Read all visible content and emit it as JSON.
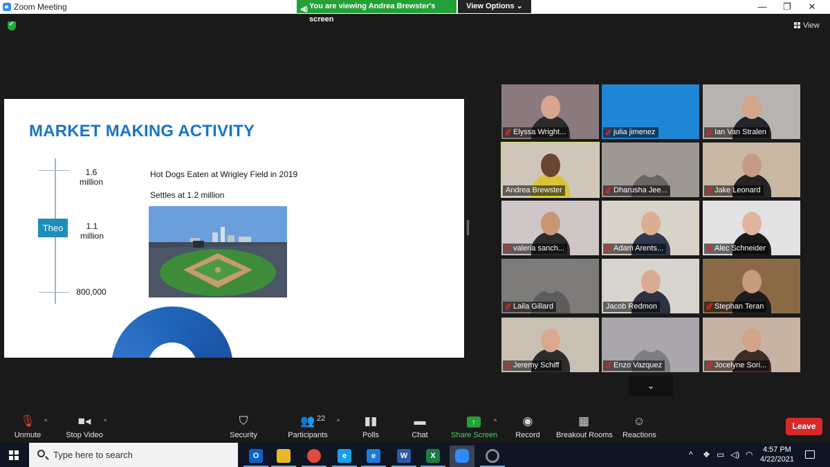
{
  "window": {
    "title": "Zoom Meeting",
    "banner": "You are viewing Andrea Brewster's screen",
    "view_options": "View Options",
    "view": "View"
  },
  "slide": {
    "title": "MARKET MAKING ACTIVITY",
    "axis": {
      "top_label": "1.6 million",
      "mid_label": "1.1 million",
      "bottom_label": "800,000",
      "marker": "Theo"
    },
    "line1": "Hot Dogs Eaten at Wrigley Field in 2019",
    "line2": "Settles at 1.2 million",
    "photo_icon": "baseball-stadium-photo"
  },
  "participants": [
    {
      "name": "Elyssa Wright...",
      "bg": "#8a7a7e",
      "skin": "#d9a58f",
      "shirt": "#2a2a2a",
      "muted": true
    },
    {
      "name": "julia jimenez",
      "bg": "#1f86d6",
      "skin": "#1f86d6",
      "shirt": "#1f86d6",
      "muted": true
    },
    {
      "name": "Ian Van Stralen",
      "bg": "#b7b3b0",
      "skin": "#d3a68c",
      "shirt": "#24262c",
      "muted": true
    },
    {
      "name": "Andrea Brewster",
      "bg": "#cfc6b9",
      "skin": "#6b4531",
      "shirt": "#d8c43a",
      "muted": false,
      "active": true
    },
    {
      "name": "Dharusha Jee...",
      "bg": "#9d9891",
      "skin": "#9d9891",
      "shirt": "#6a6560",
      "muted": true
    },
    {
      "name": "Jake Leonard",
      "bg": "#c8b8a3",
      "skin": "#c79b83",
      "shirt": "#242424",
      "muted": true
    },
    {
      "name": "valeria sanch...",
      "bg": "#cfc7c7",
      "skin": "#c99674",
      "shirt": "#2b2b2b",
      "muted": true
    },
    {
      "name": "Adam Arents...",
      "bg": "#d8d2c8",
      "skin": "#dcae92",
      "shirt": "#2e3a4d",
      "muted": true
    },
    {
      "name": "Alec Schneider",
      "bg": "#e2e2e2",
      "skin": "#e0b49e",
      "shirt": "#1a1a1a",
      "muted": true
    },
    {
      "name": "Laila Gillard",
      "bg": "#7e7c7b",
      "skin": "#7e7c7b",
      "shirt": "#5e5c5b",
      "muted": true
    },
    {
      "name": "Jacob Redmon",
      "bg": "#d7d4cf",
      "skin": "#d9ab92",
      "shirt": "#2d3240",
      "muted": false
    },
    {
      "name": "Stephan Teran",
      "bg": "#8a6a45",
      "skin": "#c89b7f",
      "shirt": "#1c1c1c",
      "muted": true
    },
    {
      "name": "Jeremy Schiff",
      "bg": "#c9c0b4",
      "skin": "#d9a88d",
      "shirt": "#2c2c2c",
      "muted": true
    },
    {
      "name": "Enzo Vazquez",
      "bg": "#a9a7ab",
      "skin": "#a9a7ab",
      "shirt": "#7f7d82",
      "muted": true
    },
    {
      "name": "Jocelyne Sori...",
      "bg": "#c7b3a3",
      "skin": "#d3a487",
      "shirt": "#3a2d2a",
      "muted": true
    }
  ],
  "toolbar": {
    "unmute": "Unmute",
    "stop_video": "Stop Video",
    "security": "Security",
    "participants": "Participants",
    "participants_count": "22",
    "polls": "Polls",
    "chat": "Chat",
    "share_screen": "Share Screen",
    "record": "Record",
    "breakout_rooms": "Breakout Rooms",
    "reactions": "Reactions",
    "leave": "Leave"
  },
  "taskbar": {
    "search_placeholder": "Type here to search",
    "time": "4:57 PM",
    "date": "4/22/2021",
    "apps": [
      {
        "name": "outlook-icon",
        "label": "O",
        "color": "#0a64c8"
      },
      {
        "name": "file-explorer-icon",
        "label": "",
        "color": "#e8b82a"
      },
      {
        "name": "chrome-icon",
        "label": "",
        "color": "#e04a3a"
      },
      {
        "name": "internet-explorer-icon",
        "label": "e",
        "color": "#1aa0e6"
      },
      {
        "name": "edge-icon",
        "label": "e",
        "color": "#1d7bd8"
      },
      {
        "name": "word-icon",
        "label": "W",
        "color": "#2b5ba8"
      },
      {
        "name": "excel-icon",
        "label": "X",
        "color": "#1f7a44"
      },
      {
        "name": "zoom-icon",
        "label": "",
        "color": "#2d8cff"
      },
      {
        "name": "recorder-icon",
        "label": "",
        "color": "#8a8a8a"
      }
    ]
  }
}
